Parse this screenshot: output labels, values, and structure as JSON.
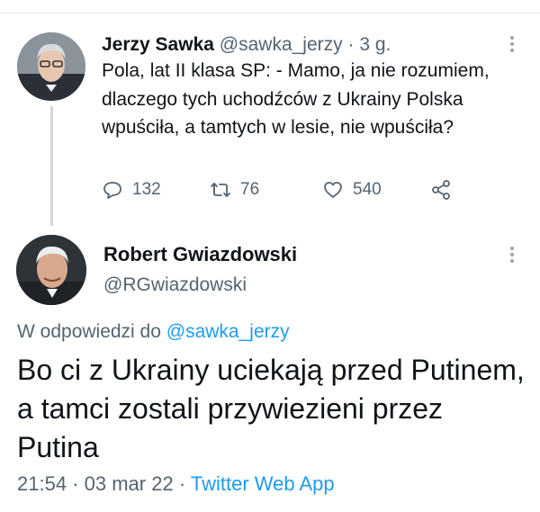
{
  "colors": {
    "text": "#0f1419",
    "secondary": "#536471",
    "link": "#1d9bf0",
    "thread_line": "#cfd9de"
  },
  "parent_tweet": {
    "author_name": "Jerzy Sawka",
    "author_handle": "@sawka_jerzy",
    "separator": "·",
    "time": "3 g.",
    "text": "Pola, lat II klasa SP: - Mamo, ja nie rozumiem, dlaczego tych uchodźców z Ukrainy Polska wpuściła, a tamtych w lesie, nie wpuściła?",
    "actions": {
      "replies": "132",
      "retweets": "76",
      "likes": "540"
    }
  },
  "reply_tweet": {
    "author_name": "Robert Gwiazdowski",
    "author_handle": "@RGwiazdowski",
    "replying_to_label": "W odpowiedzi do",
    "replying_to_handle": "@sawka_jerzy",
    "text": "Bo ci z Ukrainy uciekają przed Putinem, a tamci zostali przywiezieni przez Putina",
    "time": "21:54",
    "date": "03 mar 22",
    "meta_separator": "·",
    "source": "Twitter Web App"
  }
}
